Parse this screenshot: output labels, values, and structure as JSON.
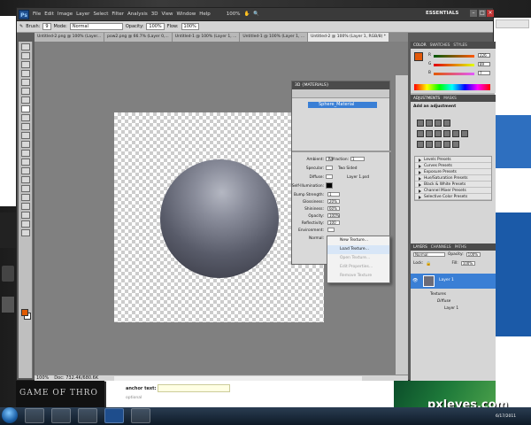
{
  "ps": {
    "logo": "Ps",
    "menu": [
      "File",
      "Edit",
      "Image",
      "Layer",
      "Select",
      "Filter",
      "Analysis",
      "3D",
      "View",
      "Window",
      "Help"
    ],
    "zoom": "100%",
    "workspace": "ESSENTIALS",
    "options": {
      "brush_label": "Brush:",
      "brush_size": "9",
      "mode_label": "Mode:",
      "mode_value": "Normal",
      "opacity_label": "Opacity:",
      "opacity_value": "100%",
      "flow_label": "Flow:",
      "flow_value": "100%"
    },
    "tabs": [
      "Untitled-2.png @ 100% (Layer...",
      "pow2.png @ 66.7% (Layer 0,...",
      "Untitled-1 @ 100% (Layer 1, ...",
      "Untitled-1 @ 100% (Layer 1, ...",
      "Untitled-2 @ 100% (Layer 1, RGB/8) *"
    ],
    "status": {
      "zoom": "100%",
      "doc": "Doc: 732.4K/680.6K"
    }
  },
  "panel3d": {
    "title": "3D {MATERIALS}",
    "material_name": "Sphere_Material",
    "props": [
      {
        "label": "Ambient:",
        "value": ""
      },
      {
        "label": "Refraction:",
        "value": "1"
      },
      {
        "label": "Specular:",
        "value": "Two Sided"
      },
      {
        "label": "Diffuse:",
        "value": "Layer 1.psd"
      },
      {
        "label": "Self-Illumination:",
        "value": ""
      },
      {
        "label": "Bump Strength:",
        "value": "1"
      },
      {
        "label": "Glossiness:",
        "value": "20%"
      },
      {
        "label": "Shininess:",
        "value": "60%"
      },
      {
        "label": "Opacity:",
        "value": "100%"
      },
      {
        "label": "Reflectivity:",
        "value": "100"
      },
      {
        "label": "Environment:",
        "value": ""
      },
      {
        "label": "Normal:",
        "value": ""
      }
    ]
  },
  "context_menu": [
    "New Texture...",
    "Load Texture...",
    "Open Texture...",
    "Edit Properties...",
    "Remove Texture"
  ],
  "color_panel": {
    "tabs": [
      "COLOR",
      "SWATCHES",
      "STYLES"
    ],
    "r": "226",
    "g": "89",
    "b": "7",
    "r_label": "R",
    "g_label": "G",
    "b_label": "B",
    "fg_color": "#e2590a"
  },
  "adjustments": {
    "tabs": [
      "ADJUSTMENTS",
      "MASKS"
    ],
    "title": "Add an adjustment",
    "presets": [
      "Levels Presets",
      "Curves Presets",
      "Exposure Presets",
      "Hue/Saturation Presets",
      "Black & White Presets",
      "Channel Mixer Presets",
      "Selective Color Presets"
    ]
  },
  "layers": {
    "tabs": [
      "LAYERS",
      "CHANNELS",
      "PATHS"
    ],
    "blend": "Normal",
    "opacity_label": "Opacity:",
    "opacity": "100%",
    "lock_label": "Lock:",
    "fill_label": "Fill:",
    "fill": "100%",
    "layer_name": "Layer 1",
    "textures": "Textures",
    "diffuse": "Diffuse",
    "sub_layer": "Layer 1"
  },
  "web": {
    "game_text": "GAME OF THRO",
    "anchor_label": "anchor text:",
    "optional": "optional",
    "watermark": "pxleyes.com",
    "clock": "6/17/2011"
  }
}
